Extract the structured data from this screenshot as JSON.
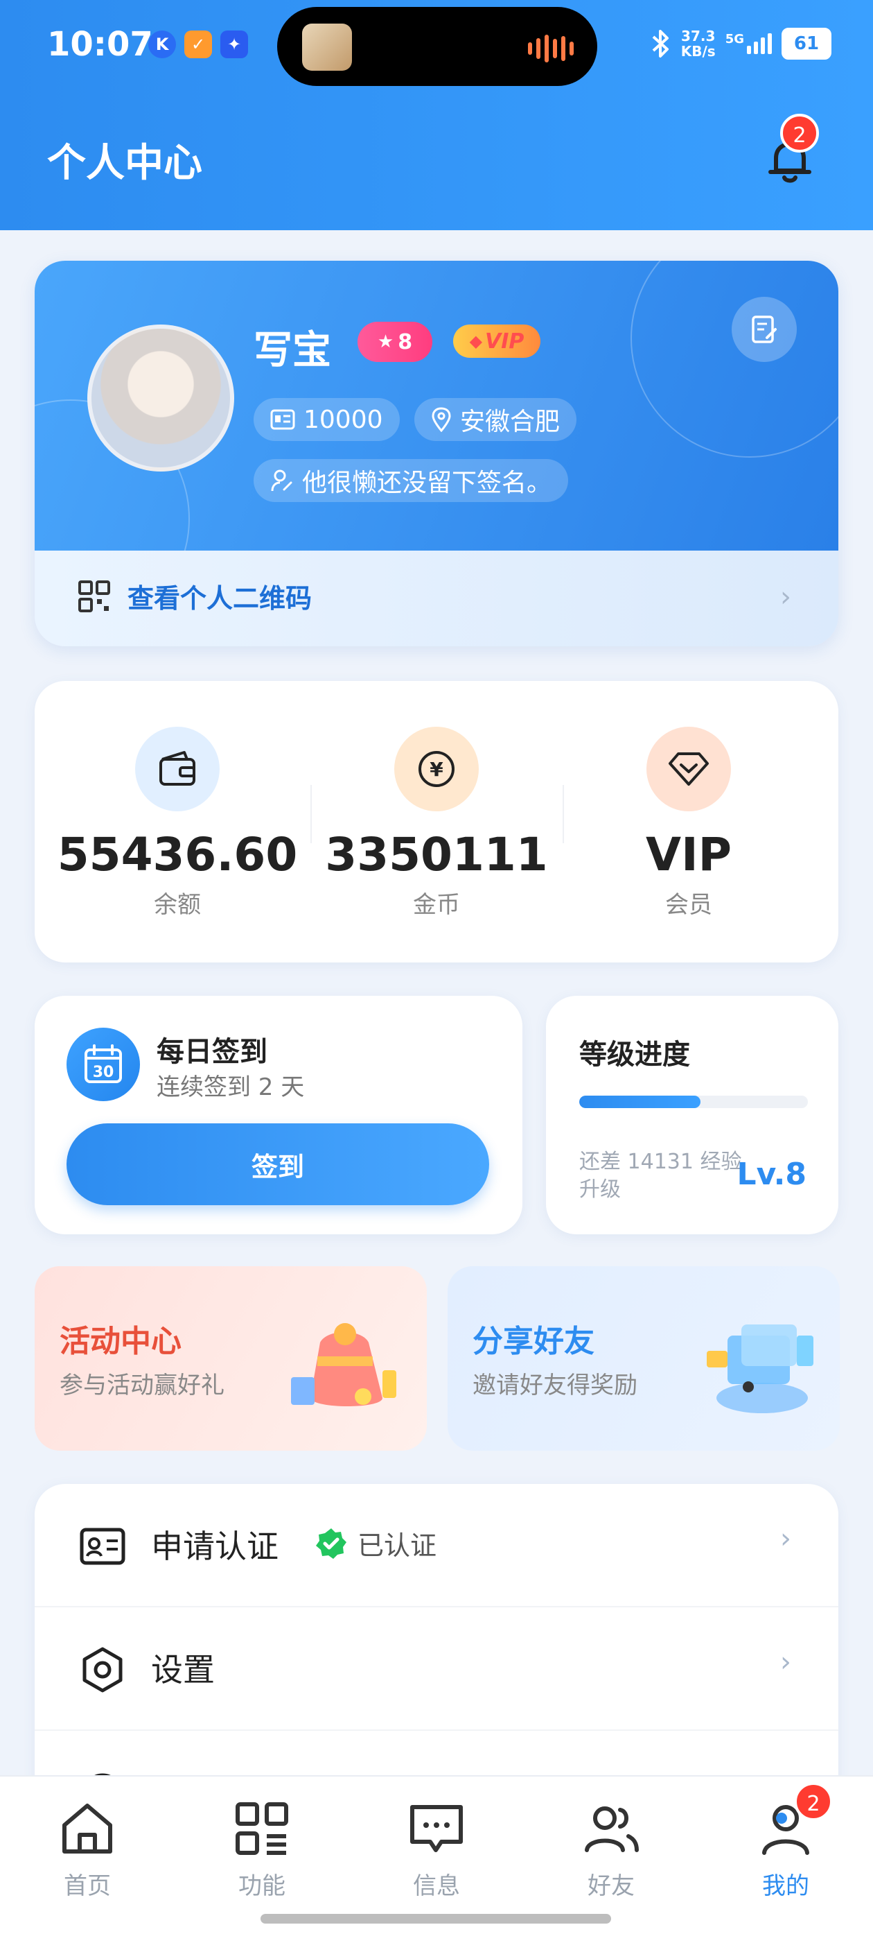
{
  "status_bar": {
    "time": "10:07",
    "net_speed_value": "37.3",
    "net_speed_unit": "KB/s",
    "network": "5G",
    "battery": "61"
  },
  "header": {
    "title": "个人中心",
    "notification_count": "2"
  },
  "profile": {
    "name": "写宝",
    "level_badge": "8",
    "vip_badge": "VIP",
    "user_id": "10000",
    "location": "安徽合肥",
    "signature": "他很懒还没留下签名。",
    "qr_label": "查看个人二维码"
  },
  "stats": [
    {
      "value": "55436.60",
      "label": "余额",
      "icon": "wallet-icon",
      "color": "#2d8cf0"
    },
    {
      "value": "3350111",
      "label": "金币",
      "icon": "coin-icon",
      "color": "#ff7a1a"
    },
    {
      "value": "VIP",
      "label": "会员",
      "icon": "diamond-icon",
      "color": "#ff6a3d"
    }
  ],
  "checkin": {
    "title": "每日签到",
    "subtitle": "连续签到 2 天",
    "calendar_day": "30",
    "button": "签到"
  },
  "level": {
    "title": "等级进度",
    "progress": 0.53,
    "hint": "还差 14131 经验升级",
    "level": "Lv.8"
  },
  "promos": [
    {
      "title": "活动中心",
      "subtitle": "参与活动赢好礼",
      "title_color": "#e8503a"
    },
    {
      "title": "分享好友",
      "subtitle": "邀请好友得奖励",
      "title_color": "#2d8cf0"
    }
  ],
  "menu": [
    {
      "label": "申请认证",
      "status": "已认证",
      "icon": "id-card-icon"
    },
    {
      "label": "设置",
      "icon": "settings-icon"
    }
  ],
  "tabs": [
    {
      "label": "首页",
      "icon": "home-icon"
    },
    {
      "label": "功能",
      "icon": "apps-icon"
    },
    {
      "label": "信息",
      "icon": "message-icon"
    },
    {
      "label": "好友",
      "icon": "friends-icon"
    },
    {
      "label": "我的",
      "icon": "profile-icon",
      "active": true,
      "badge": "2"
    }
  ],
  "colors": {
    "primary": "#2d8cf0",
    "badge_red": "#ff3b30",
    "verified_green": "#22c55e"
  }
}
